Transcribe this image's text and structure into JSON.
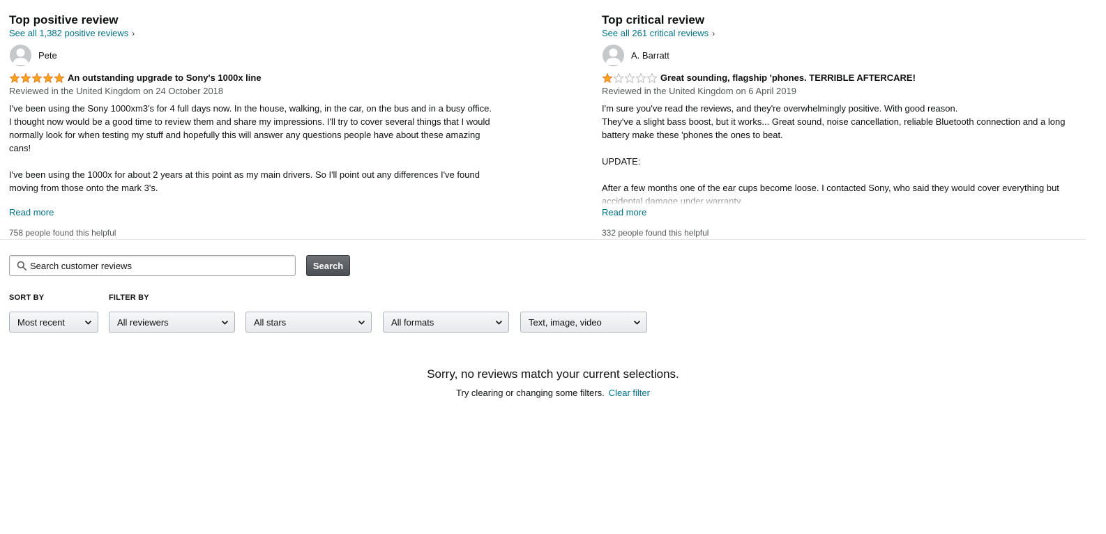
{
  "positive": {
    "heading": "Top positive review",
    "see_all": "See all 1,382 positive reviews",
    "reviewer": "Pete",
    "rating": 5,
    "title": "An outstanding upgrade to Sony's 1000x line",
    "date": "Reviewed in the United Kingdom on 24 October 2018",
    "body": [
      "I've been using the Sony 1000xm3's for 4 full days now. In the house, walking, in the car, on the bus and in a busy office. I thought now would be a good time to review them and share my impressions. I'll try to cover several things that I would normally look for when testing my stuff and hopefully this will answer any questions people have about these amazing cans!",
      "I've been using the 1000x for about 2 years at this point as my main drivers. So I'll point out any differences I've found moving from those onto the mark 3's."
    ],
    "read_more": "Read more",
    "helpful": "758 people found this helpful"
  },
  "critical": {
    "heading": "Top critical review",
    "see_all": "See all 261 critical reviews",
    "reviewer": "A. Barratt",
    "rating": 1,
    "title": "Great sounding, flagship 'phones. TERRIBLE AFTERCARE!",
    "date": "Reviewed in the United Kingdom on 6 April 2019",
    "body": [
      "I'm sure you've read the reviews, and they're overwhelmingly positive. With good reason.\nThey've a slight bass boost, but it works... Great sound, noise cancellation, reliable Bluetooth connection and a long battery make these 'phones the ones to beat.",
      "UPDATE:",
      "After a few months one of the ear cups become loose. I contacted Sony, who said they would cover everything but accidental damage under warranty ."
    ],
    "read_more": "Read more",
    "helpful": "332 people found this helpful"
  },
  "search": {
    "placeholder": "Search customer reviews",
    "button": "Search"
  },
  "filters": {
    "sort_label": "SORT BY",
    "filter_label": "FILTER BY",
    "sort_value": "Most recent",
    "reviewers_value": "All reviewers",
    "stars_value": "All stars",
    "formats_value": "All formats",
    "media_value": "Text, image, video"
  },
  "empty_state": {
    "message": "Sorry, no reviews match your current selections.",
    "hint": "Try clearing or changing some filters.",
    "clear_link": "Clear filter"
  },
  "colors": {
    "link": "#007185",
    "star": "#ffa41c",
    "muted": "#565959"
  },
  "icons": {
    "avatar": "user-avatar-icon",
    "search": "magnifier-icon",
    "chevron": "chevron-down-icon",
    "star": "star-icon"
  }
}
